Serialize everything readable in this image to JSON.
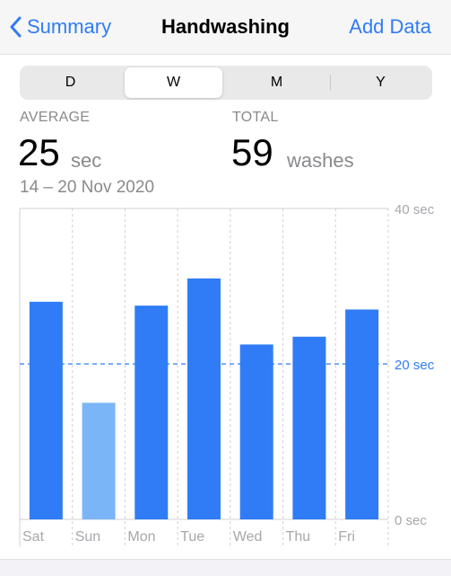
{
  "nav": {
    "back_label": "Summary",
    "title": "Handwashing",
    "action_label": "Add Data"
  },
  "segments": [
    {
      "label": "D",
      "selected": false
    },
    {
      "label": "W",
      "selected": true
    },
    {
      "label": "M",
      "selected": false
    },
    {
      "label": "Y",
      "selected": false
    }
  ],
  "stats": {
    "average_label": "AVERAGE",
    "average_value": "25",
    "average_unit": "sec",
    "total_label": "TOTAL",
    "total_value": "59",
    "total_unit": "washes",
    "date_range": "14 – 20 Nov 2020"
  },
  "colors": {
    "accent": "#2f7cf6",
    "bar": "#2f7cf6",
    "bar_light": "#7ab5f8",
    "average_line": "#2f7cf6",
    "grid": "#d0d0d5",
    "axis_text": "#a7a7ac"
  },
  "chart_data": {
    "type": "bar",
    "categories": [
      "Sat",
      "Sun",
      "Mon",
      "Tue",
      "Wed",
      "Thu",
      "Fri"
    ],
    "values": [
      28,
      15,
      27.5,
      31,
      22.5,
      23.5,
      27
    ],
    "highlighted": [
      true,
      false,
      true,
      true,
      true,
      true,
      true
    ],
    "ylim": [
      0,
      40
    ],
    "y_ticks": [
      {
        "value": 40,
        "label": "40 sec"
      },
      {
        "value": 20,
        "label": "20 sec"
      },
      {
        "value": 0,
        "label": "0 sec"
      }
    ],
    "average": 20,
    "average_label": "20 sec",
    "legend": "none",
    "grid": true
  }
}
